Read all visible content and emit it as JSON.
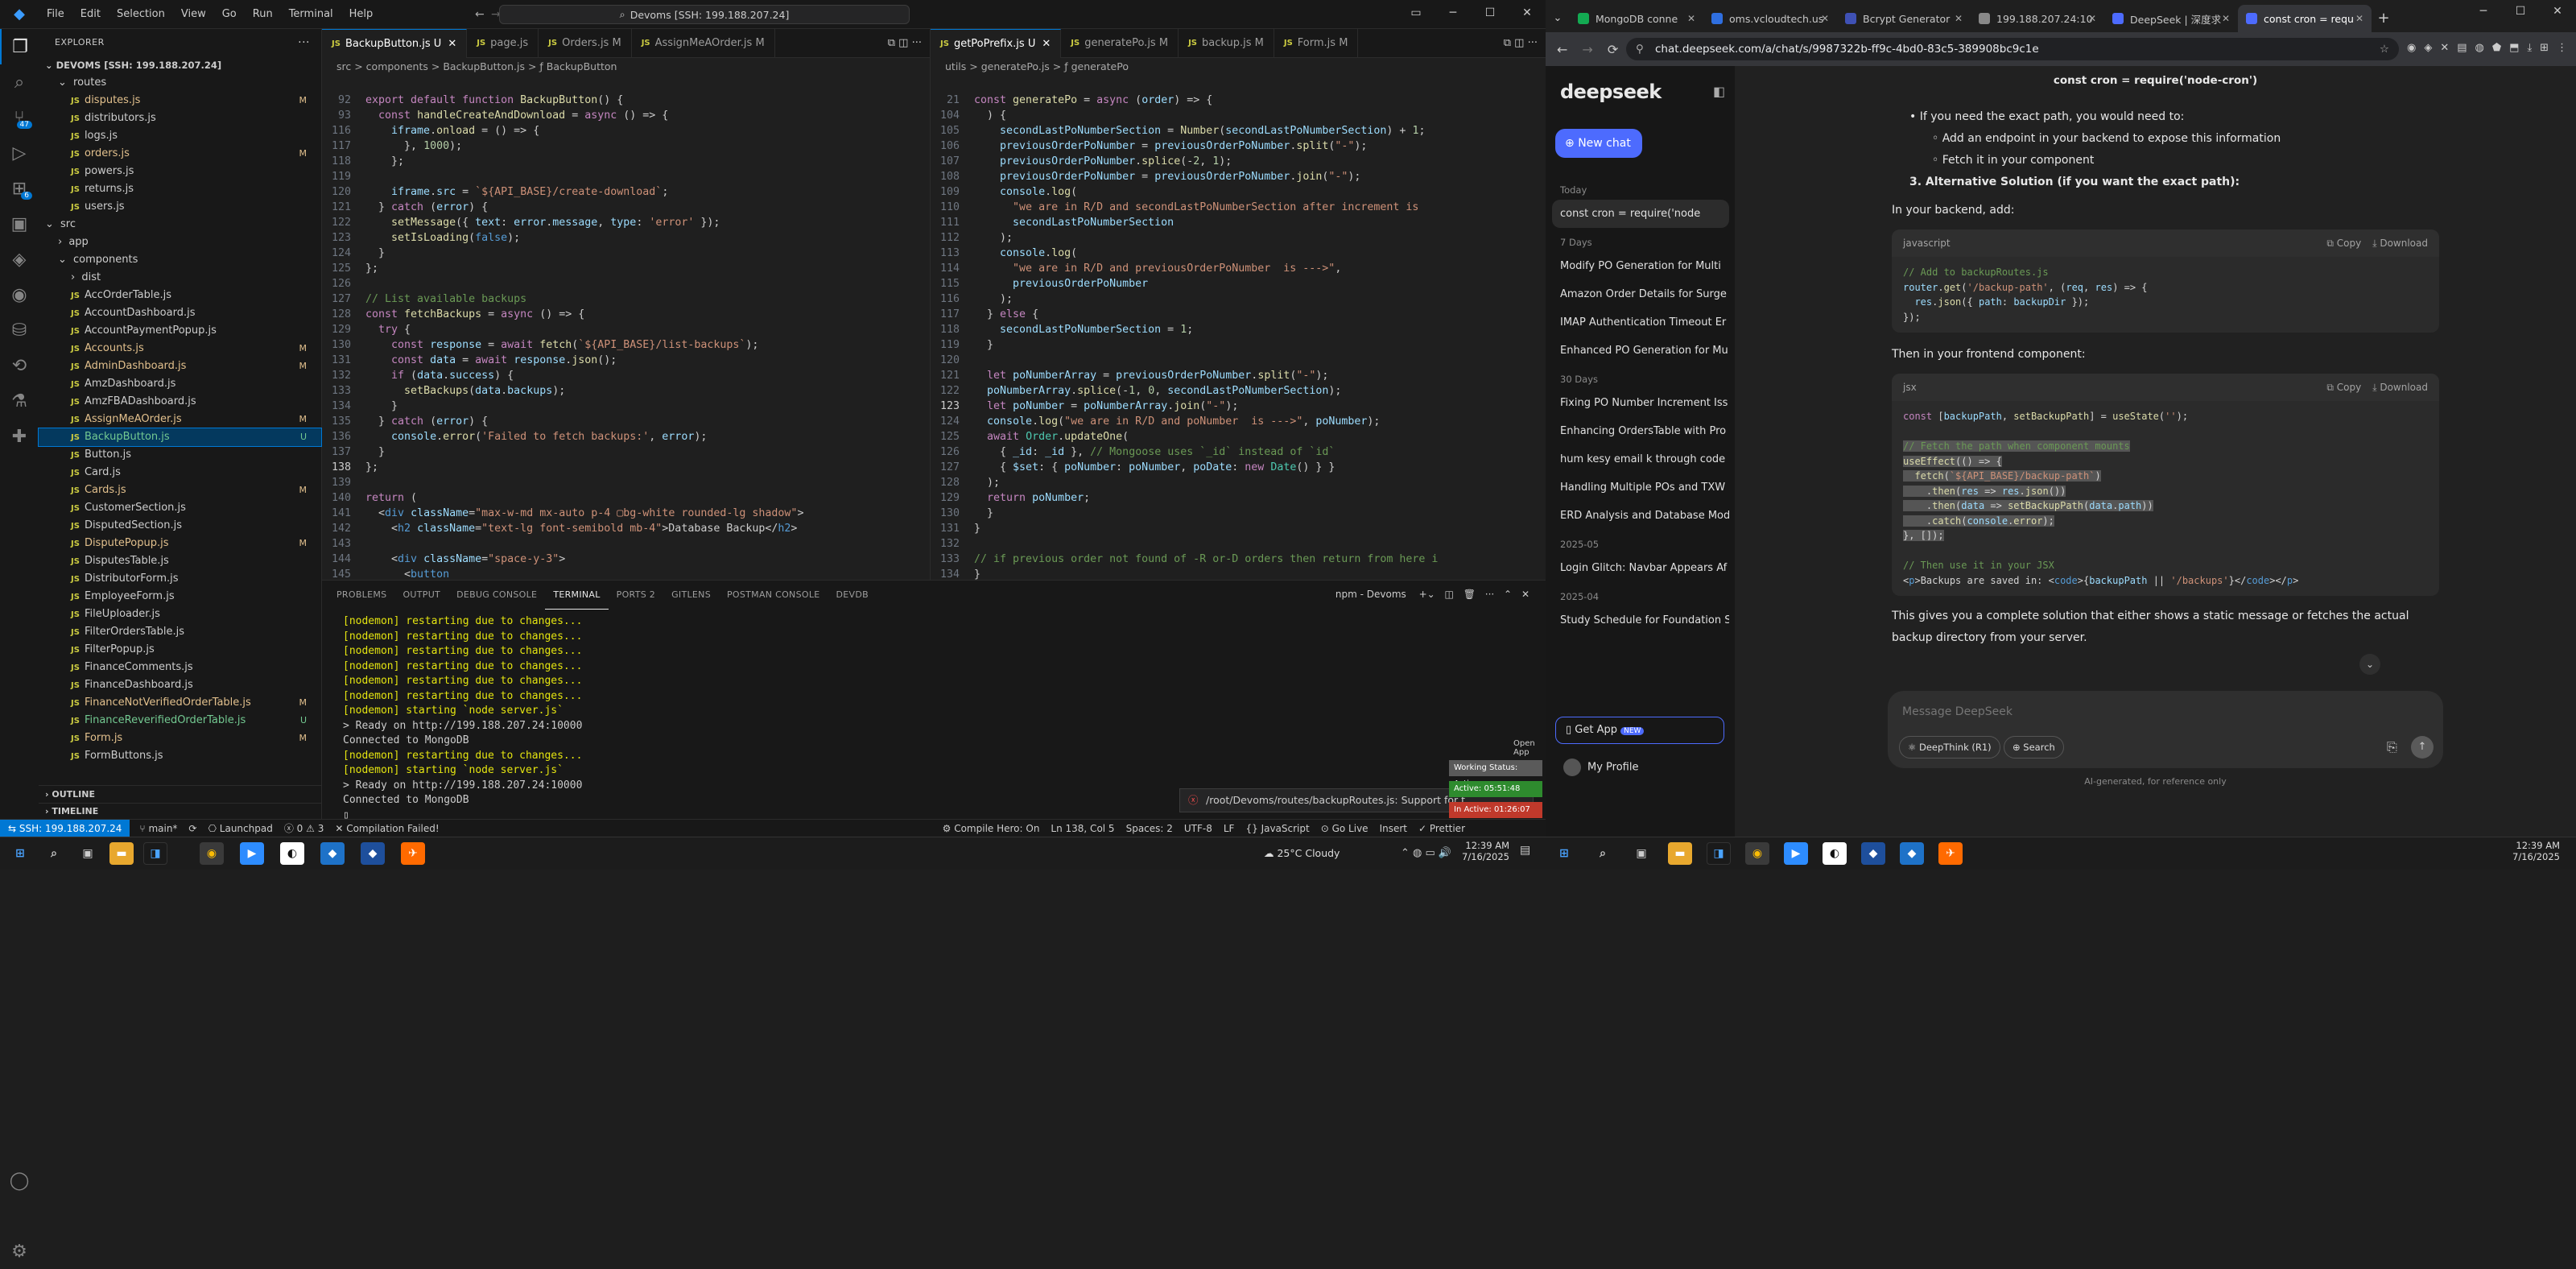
{
  "vscode": {
    "menu": [
      "File",
      "Edit",
      "Selection",
      "View",
      "Go",
      "Run",
      "Terminal",
      "Help"
    ],
    "search": "Devoms [SSH: 199.188.207.24]",
    "explorer_title": "EXPLORER",
    "root": "DEVOMS [SSH: 199.188.207.24]",
    "tree": [
      {
        "label": "routes",
        "type": "folder",
        "indent": 1,
        "status": ""
      },
      {
        "label": "disputes.js",
        "type": "js",
        "indent": 2,
        "status": "M"
      },
      {
        "label": "distributors.js",
        "type": "js",
        "indent": 2,
        "status": ""
      },
      {
        "label": "logs.js",
        "type": "js",
        "indent": 2,
        "status": ""
      },
      {
        "label": "orders.js",
        "type": "js",
        "indent": 2,
        "status": "M"
      },
      {
        "label": "powers.js",
        "type": "js",
        "indent": 2,
        "status": ""
      },
      {
        "label": "returns.js",
        "type": "js",
        "indent": 2,
        "status": ""
      },
      {
        "label": "users.js",
        "type": "js",
        "indent": 2,
        "status": ""
      },
      {
        "label": "src",
        "type": "folder",
        "indent": 0,
        "status": ""
      },
      {
        "label": "app",
        "type": "folder-c",
        "indent": 1,
        "status": ""
      },
      {
        "label": "components",
        "type": "folder",
        "indent": 1,
        "status": ""
      },
      {
        "label": "dist",
        "type": "folder-c",
        "indent": 2,
        "status": ""
      },
      {
        "label": "AccOrderTable.js",
        "type": "js",
        "indent": 2,
        "status": ""
      },
      {
        "label": "AccountDashboard.js",
        "type": "js",
        "indent": 2,
        "status": ""
      },
      {
        "label": "AccountPaymentPopup.js",
        "type": "js",
        "indent": 2,
        "status": ""
      },
      {
        "label": "Accounts.js",
        "type": "js",
        "indent": 2,
        "status": "M"
      },
      {
        "label": "AdminDashboard.js",
        "type": "js",
        "indent": 2,
        "status": "M"
      },
      {
        "label": "AmzDashboard.js",
        "type": "js",
        "indent": 2,
        "status": ""
      },
      {
        "label": "AmzFBADashboard.js",
        "type": "js",
        "indent": 2,
        "status": ""
      },
      {
        "label": "AssignMeAOrder.js",
        "type": "js",
        "indent": 2,
        "status": "M"
      },
      {
        "label": "BackupButton.js",
        "type": "js",
        "indent": 2,
        "status": "U",
        "selected": true
      },
      {
        "label": "Button.js",
        "type": "js",
        "indent": 2,
        "status": ""
      },
      {
        "label": "Card.js",
        "type": "js",
        "indent": 2,
        "status": ""
      },
      {
        "label": "Cards.js",
        "type": "js",
        "indent": 2,
        "status": "M"
      },
      {
        "label": "CustomerSection.js",
        "type": "js",
        "indent": 2,
        "status": ""
      },
      {
        "label": "DisputedSection.js",
        "type": "js",
        "indent": 2,
        "status": ""
      },
      {
        "label": "DisputePopup.js",
        "type": "js",
        "indent": 2,
        "status": "M"
      },
      {
        "label": "DisputesTable.js",
        "type": "js",
        "indent": 2,
        "status": ""
      },
      {
        "label": "DistributorForm.js",
        "type": "js",
        "indent": 2,
        "status": ""
      },
      {
        "label": "EmployeeForm.js",
        "type": "js",
        "indent": 2,
        "status": ""
      },
      {
        "label": "FileUploader.js",
        "type": "js",
        "indent": 2,
        "status": ""
      },
      {
        "label": "FilterOrdersTable.js",
        "type": "js",
        "indent": 2,
        "status": ""
      },
      {
        "label": "FilterPopup.js",
        "type": "js",
        "indent": 2,
        "status": ""
      },
      {
        "label": "FinanceComments.js",
        "type": "js",
        "indent": 2,
        "status": ""
      },
      {
        "label": "FinanceDashboard.js",
        "type": "js",
        "indent": 2,
        "status": ""
      },
      {
        "label": "FinanceNotVerifiedOrderTable.js",
        "type": "js",
        "indent": 2,
        "status": "M"
      },
      {
        "label": "FinanceReverifiedOrderTable.js",
        "type": "js",
        "indent": 2,
        "status": "U"
      },
      {
        "label": "Form.js",
        "type": "js",
        "indent": 2,
        "status": "M"
      },
      {
        "label": "FormButtons.js",
        "type": "js",
        "indent": 2,
        "status": ""
      }
    ],
    "outline": "OUTLINE",
    "timeline": "TIMELINE",
    "left_tabs": [
      "BackupButton.js U",
      "page.js",
      "Orders.js M",
      "AssignMeAOrder.js M"
    ],
    "left_crumb": "src > components > BackupButton.js > ƒ BackupButton",
    "right_tabs": [
      "getPoPrefix.js U",
      "generatePo.js M",
      "backup.js M",
      "Form.js M"
    ],
    "right_crumb": "utils > generatePo.js > ƒ generatePo",
    "panel_tabs": [
      "PROBLEMS",
      "OUTPUT",
      "DEBUG CONSOLE",
      "TERMINAL",
      "PORTS 2",
      "GITLENS",
      "POSTMAN CONSOLE",
      "DEVDB"
    ],
    "panel_right": "npm - Devoms",
    "terminal": [
      "[nodemon] restarting due to changes...",
      "[nodemon] restarting due to changes...",
      "[nodemon] restarting due to changes...",
      "[nodemon] restarting due to changes...",
      "[nodemon] restarting due to changes...",
      "[nodemon] restarting due to changes...",
      "[nodemon] starting `node server.js`",
      "> Ready on http://199.188.207.24:10000",
      "Connected to MongoDB",
      "[nodemon] restarting due to changes...",
      "[nodemon] starting `node server.js`",
      "> Ready on http://199.188.207.24:10000",
      "Connected to MongoDB"
    ],
    "notification": "/root/Devoms/routes/backupRoutes.js: Support for t",
    "work": {
      "title": "Working Status: Active",
      "active": "Active: 05:51:48",
      "inactive": "In Active: 01:26:07",
      "open": "Open App"
    },
    "status": {
      "remote": "SSH: 199.188.207.24",
      "branch": "main*",
      "launch": "Launchpad",
      "errors": "0",
      "warnings": "3",
      "compile": "Compilation Failed!",
      "compile_hero": "Compile Hero: On",
      "pos": "Ln 138, Col 5",
      "spaces": "Spaces: 2",
      "enc": "UTF-8",
      "eol": "LF",
      "lang": "JavaScript",
      "golive": "Go Live",
      "insert": "Insert",
      "prettier": "Prettier"
    }
  },
  "chrome": {
    "tabs": [
      "MongoDB conne",
      "oms.vcloudtech.us",
      "Bcrypt Generator",
      "199.188.207.24:10",
      "DeepSeek | 深度求",
      "const cron = requ"
    ],
    "url": "chat.deepseek.com/a/chat/s/9987322b-ff9c-4bd0-83c5-389908bc9c1e"
  },
  "deepseek": {
    "logo": "deepseek",
    "new_chat": "New chat",
    "groups": [
      {
        "label": "Today",
        "items": [
          "const cron = require('node"
        ]
      },
      {
        "label": "7 Days",
        "items": [
          "Modify PO Generation for Multi",
          "Amazon Order Details for Surge",
          "IMAP Authentication Timeout Er",
          "Enhanced PO Generation for Mu"
        ]
      },
      {
        "label": "30 Days",
        "items": [
          "Fixing PO Number Increment Iss",
          "Enhancing OrdersTable with Pro",
          "hum kesy email k through code",
          "Handling Multiple POs and TXW",
          "ERD Analysis and Database Mod"
        ]
      },
      {
        "label": "2025-05",
        "items": [
          "Login Glitch: Navbar Appears Af"
        ]
      },
      {
        "label": "2025-04",
        "items": [
          "Study Schedule for Foundation S"
        ]
      }
    ],
    "get_app": "Get App",
    "new_badge": "NEW",
    "profile": "My Profile",
    "chat_title": "const cron = require('node-cron')",
    "bullets": [
      "If you need the exact path, you would need to:",
      "Add an endpoint in your backend to expose this information",
      "Fetch it in your component"
    ],
    "alt_solution": "3. Alternative Solution (if you want the exact path):",
    "backend_text": "In your backend, add:",
    "frontend_text": "Then in your frontend component:",
    "conclusion": "This gives you a complete solution that either shows a static message or fetches the actual backup directory from your server.",
    "code1_lang": "javascript",
    "code2_lang": "jsx",
    "copy": "Copy",
    "download": "Download",
    "placeholder": "Message DeepSeek",
    "deepthink": "DeepThink (R1)",
    "search": "Search",
    "disclaimer": "AI-generated, for reference only"
  },
  "taskbar": {
    "weather": "25°C Cloudy",
    "time_left": "12:39 AM",
    "date_left": "7/16/2025",
    "time_right": "12:39 AM",
    "date_right": "7/16/2025"
  }
}
